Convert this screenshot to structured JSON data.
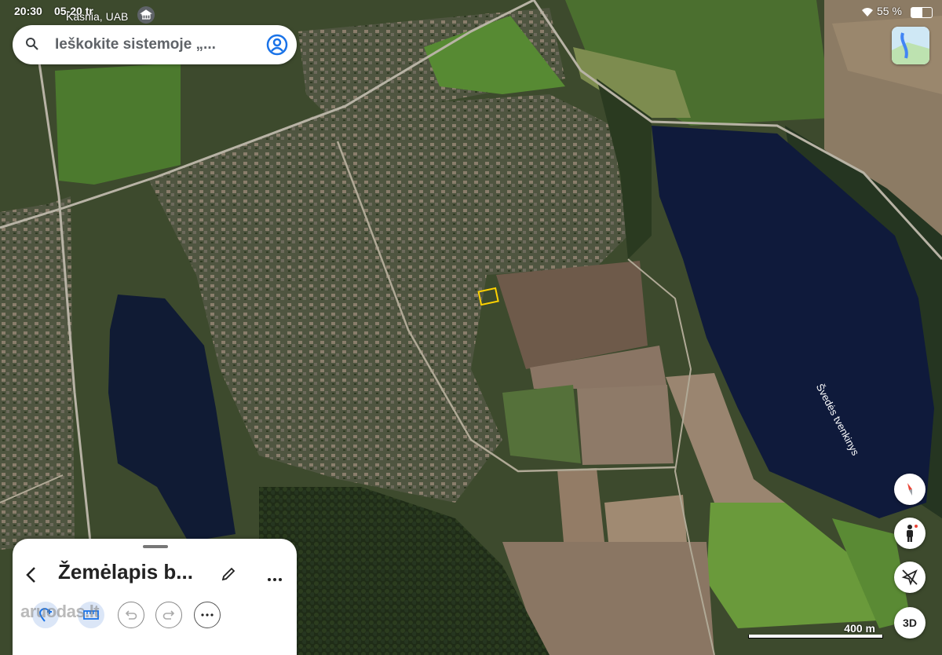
{
  "status": {
    "time": "20:30",
    "date": "05-20 tr",
    "battery": "55 %"
  },
  "search": {
    "placeholder": "Ieškokite sistemoje „..."
  },
  "map": {
    "top_label": "Kasnia, UAB",
    "lake_label": "Švedės tvenkinys",
    "scale_label": "400 m"
  },
  "sheet": {
    "title": "Žemėlapis b...",
    "watermark": "aruodas.lt"
  },
  "icons": {
    "search": "search-icon",
    "account": "account-icon",
    "layers": "layers-icon",
    "compass": "compass-icon",
    "pegman": "pegman-icon",
    "location": "location-arrow-icon",
    "back": "chevron-left-icon",
    "edit": "pencil-icon",
    "more": "more-horizontal-icon",
    "add_place": "add-place-icon",
    "measure": "ruler-icon",
    "undo": "undo-icon",
    "redo": "redo-icon"
  },
  "buttons": {
    "three_d": "3D"
  },
  "colors": {
    "accent": "#1a73e8",
    "compass_red": "#ea4335",
    "highlight": "#ffd200"
  }
}
